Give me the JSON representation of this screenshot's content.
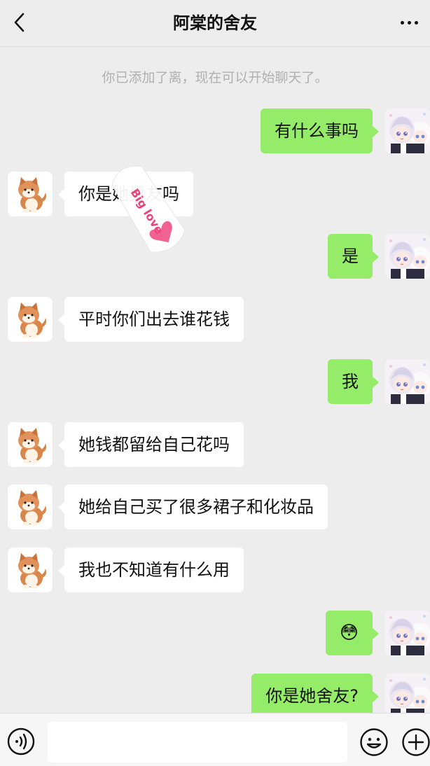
{
  "header": {
    "title": "阿棠的舍友"
  },
  "system_notice": "你已添加了离，现在可以开始聊天了。",
  "messages": [
    {
      "side": "right",
      "text": "有什么事吗"
    },
    {
      "side": "left",
      "text": "你是她男友吗"
    },
    {
      "side": "right",
      "text": "是"
    },
    {
      "side": "left",
      "text": "平时你们出去谁花钱"
    },
    {
      "side": "right",
      "text": "我"
    },
    {
      "side": "left",
      "text": "她钱都留给自己花吗"
    },
    {
      "side": "left",
      "text": "她给自己买了很多裙子和化妆品"
    },
    {
      "side": "left",
      "text": "我也不知道有什么用"
    },
    {
      "side": "right",
      "text": "😳"
    },
    {
      "side": "right",
      "text": "你是她舍友?"
    }
  ],
  "sticker": {
    "text": "Big love"
  },
  "input_bar": {
    "placeholder": ""
  },
  "colors": {
    "background": "#ededed",
    "sent_bubble": "#95ec69",
    "received_bubble": "#ffffff"
  },
  "icons": {
    "back": "chevron-left-icon",
    "more": "more-dots-icon",
    "voice": "voice-icon",
    "emoji": "emoji-icon",
    "plus": "plus-icon"
  }
}
